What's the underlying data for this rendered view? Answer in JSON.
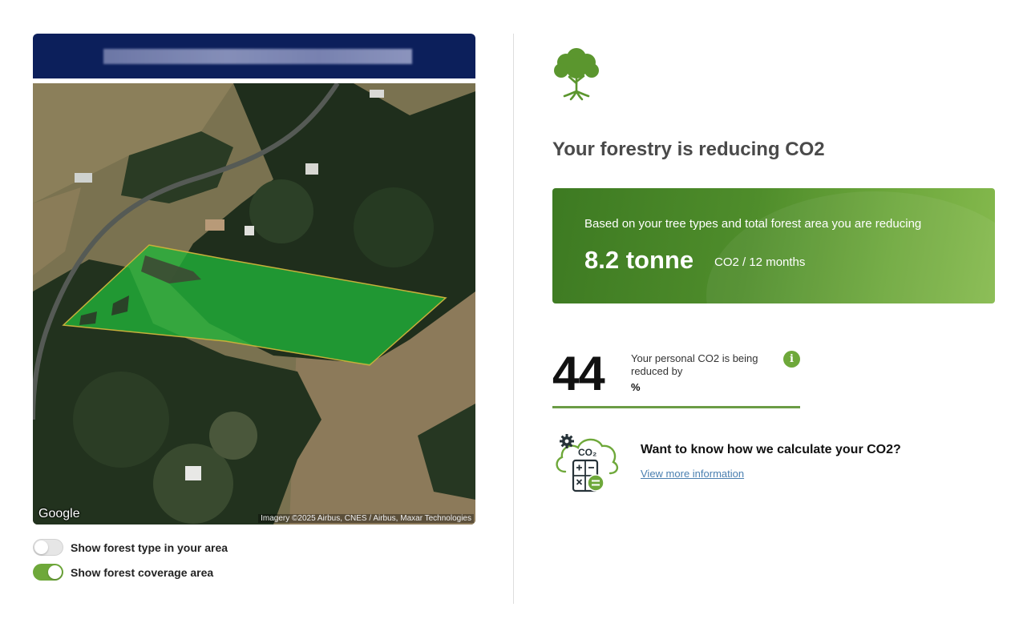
{
  "map_panel": {
    "header_title": "████████████",
    "google_logo": "Google",
    "attribution": "Imagery ©2025 Airbus, CNES / Airbus, Maxar Technologies"
  },
  "toggles": [
    {
      "label": "Show forest type in your area",
      "checked": false
    },
    {
      "label": "Show forest coverage area",
      "checked": true
    }
  ],
  "result": {
    "icon": "tree-icon",
    "title": "Your forestry is reducing CO2",
    "card": {
      "description": "Based on your tree types and total forest area you are reducing",
      "amount": "8.2 tonne",
      "unit": "CO2 / 12 months"
    },
    "personal": {
      "value": "44",
      "description": "Your personal CO2 is being reduced by",
      "unit": "%",
      "info_icon": "info-icon"
    },
    "calc": {
      "icon": "co2-calculator-icon",
      "icon_text": "CO₂",
      "title": "Want to know how we calculate your CO2?",
      "link": "View more information"
    }
  },
  "colors": {
    "header_navy": "#0c1f5b",
    "accent_green": "#6ea83a",
    "card_green": "#4f8d2b",
    "link_blue": "#4a7fb0"
  }
}
